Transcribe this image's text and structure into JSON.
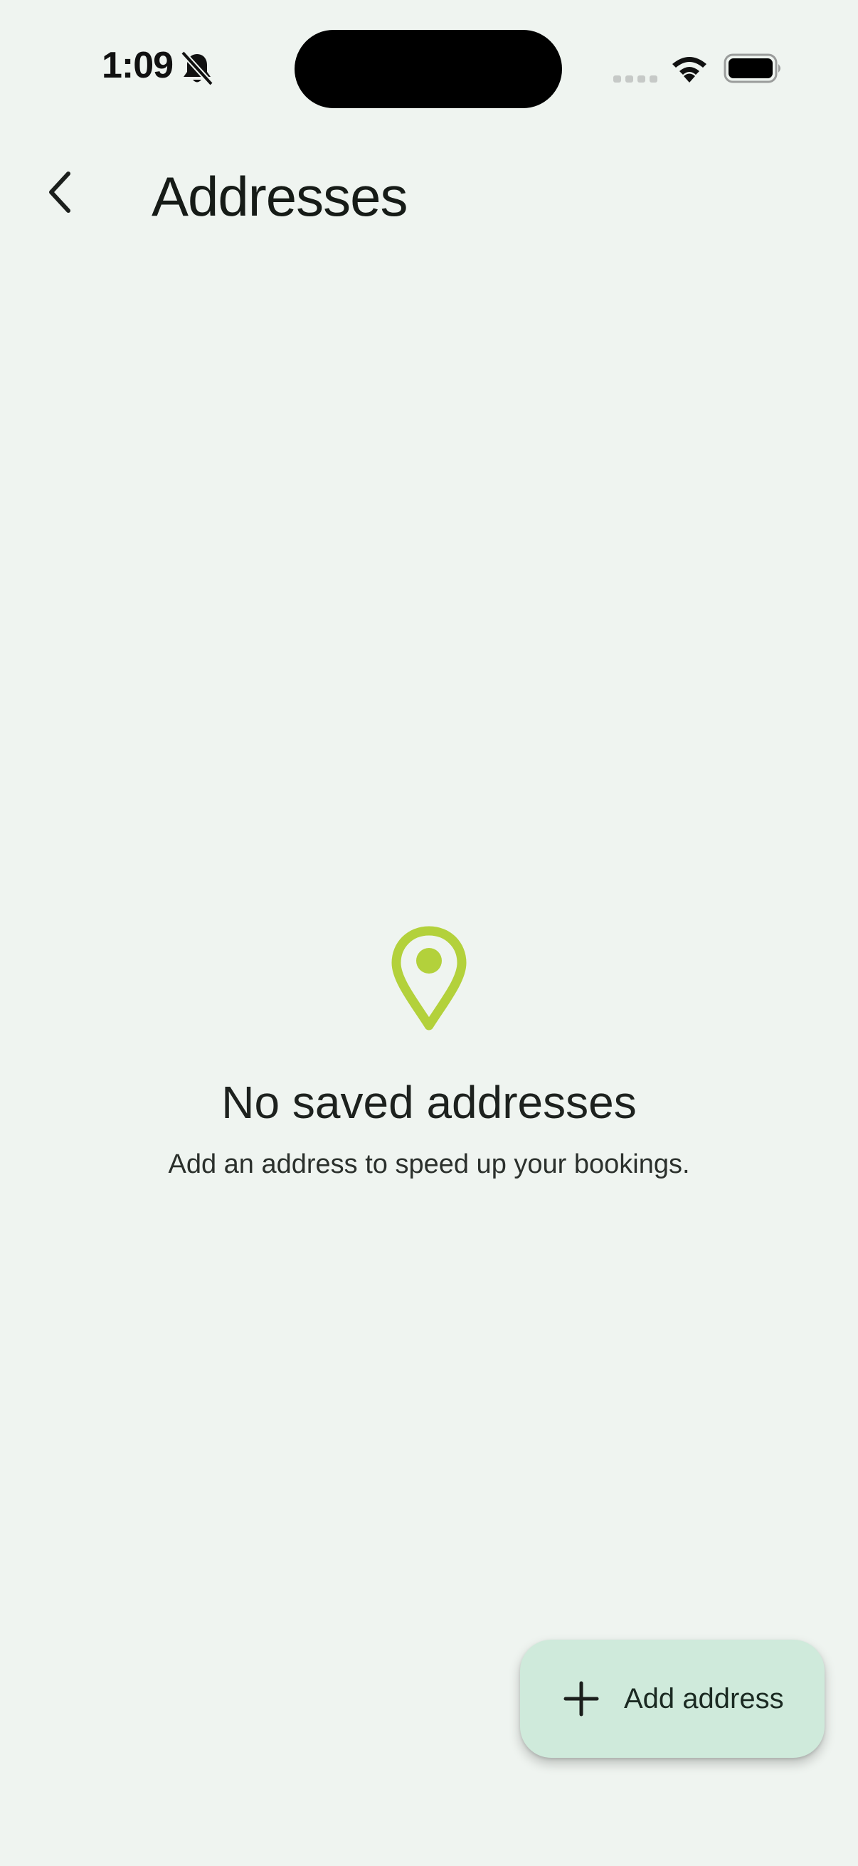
{
  "status_bar": {
    "time": "1:09",
    "icons": [
      "bell-off-icon",
      "signal-icon",
      "wifi-icon",
      "battery-icon"
    ]
  },
  "header": {
    "back_icon": "chevron-left-icon",
    "title": "Addresses"
  },
  "empty_state": {
    "icon": "map-pin-icon",
    "title": "No saved addresses",
    "subtitle": "Add an address to speed up your bookings."
  },
  "fab": {
    "icon": "plus-icon",
    "label": "Add address"
  },
  "colors": {
    "background": "#eff4f0",
    "accent_pin": "#b3d13b",
    "fab_background": "#cfeadb",
    "text_primary": "#1b1f1c"
  }
}
